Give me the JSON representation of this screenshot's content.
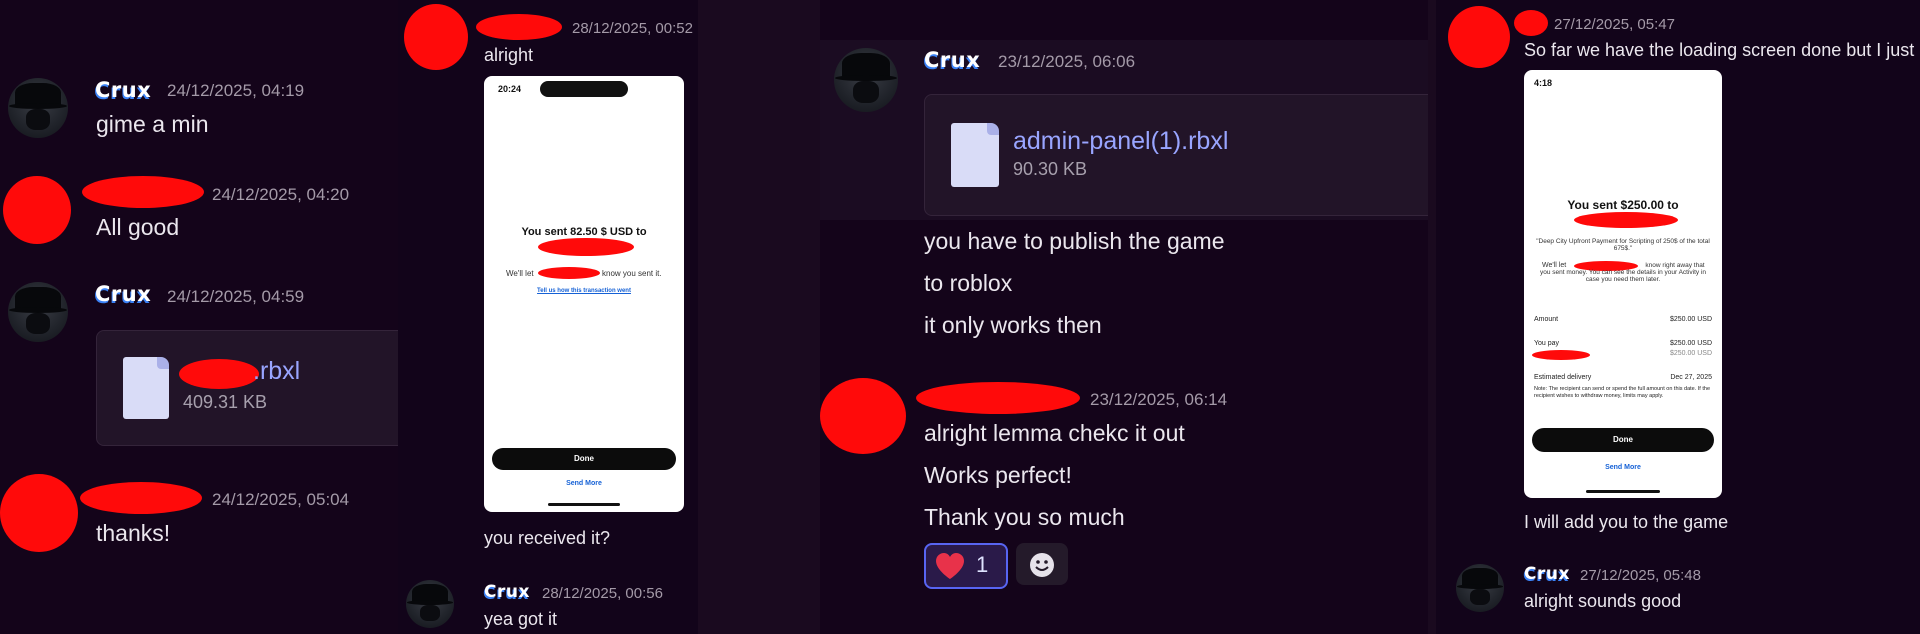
{
  "panel1": {
    "messages": [
      {
        "username": "Crux",
        "timestamp": "24/12/2025, 04:19",
        "text": "gime a min"
      },
      {
        "username": "",
        "timestamp": "24/12/2025, 04:20",
        "text": "All good"
      },
      {
        "username": "Crux",
        "timestamp": "24/12/2025, 04:59",
        "file": {
          "name": ".rbxl",
          "size": "409.31 KB"
        }
      },
      {
        "username": "",
        "timestamp": "24/12/2025, 05:04",
        "text": "thanks!"
      }
    ]
  },
  "panel2": {
    "header_timestamp": "28/12/2025, 00:52",
    "first_text": "alright",
    "phone": {
      "time": "20:24",
      "sent_text": "You sent 82.50 $ USD to",
      "we_let": "We'll let",
      "know_text": "know you sent it.",
      "feedback_link": "Tell us how this transaction went",
      "done_label": "Done",
      "send_more": "Send More"
    },
    "after_text": "you received it?",
    "reply": {
      "username": "Crux",
      "timestamp": "28/12/2025, 00:56",
      "text": "yea got it"
    }
  },
  "panel3": {
    "crux": {
      "username": "Crux",
      "timestamp": "23/12/2025, 06:06"
    },
    "file": {
      "name": "admin-panel(1).rbxl",
      "size": "90.30 KB"
    },
    "lines": [
      "you have to publish the game",
      "to roblox",
      "it only works then"
    ],
    "reply": {
      "timestamp": "23/12/2025, 06:14",
      "lines": [
        "alright lemma chekc it out",
        "Works perfect!",
        "Thank you so much"
      ]
    },
    "reaction": {
      "emoji": "heart",
      "count": "1"
    },
    "add_reaction_icon": "smiley-icon"
  },
  "panel4": {
    "header_timestamp": "27/12/2025, 05:47",
    "first_text": "So far we have the loading screen done but I just",
    "phone": {
      "time": "4:18",
      "sent_text": "You sent $250.00 to",
      "memo": "\"Deep City Upfront Payment for Scripting of 250$ of the total 675$.\"",
      "we_let": "We'll let",
      "know_text": "know right away that you sent money. You can see the details in your Activity in case you need them later.",
      "amount_label": "Amount",
      "amount_value": "$250.00 USD",
      "you_pay_label": "You pay",
      "you_pay_value": "$250.00 USD",
      "funding_value": "$250.00 USD",
      "delivery_label": "Estimated delivery",
      "delivery_value": "Dec 27, 2025",
      "fine_print": "Note: The recipient can send or spend the full amount on this date. If the recipient wishes to withdraw money, limits may apply.",
      "done_label": "Done",
      "send_more": "Send More"
    },
    "after_text": "I will add you to the game",
    "reply": {
      "username": "Crux",
      "timestamp": "27/12/2025, 05:48",
      "text": "alright sounds good"
    }
  }
}
